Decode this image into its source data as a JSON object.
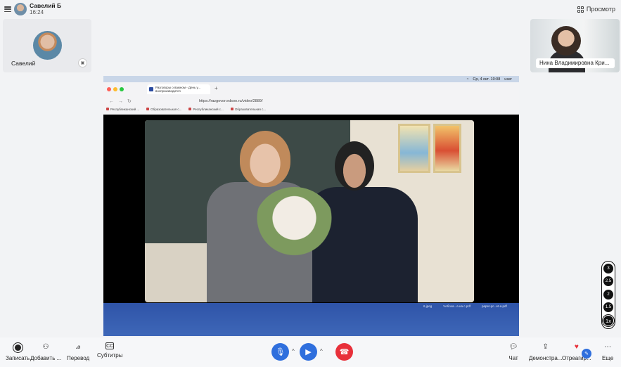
{
  "header": {
    "user_name": "Савелий Б",
    "time": "16:24",
    "view_label": "Просмотр"
  },
  "participants": {
    "self_name": "Савелий",
    "remote_name": "Нина Владимировна Кри..."
  },
  "shared_screen": {
    "mac_status": [
      "Ср, 4 окт. 10:08",
      "user"
    ],
    "tab_title": "Разговоры о важном - День у...",
    "tab_subtitle": "воспроизводится",
    "url": "https://razgovor.edsoo.ru/video/2889/",
    "bookmarks": [
      "Республиканский ...",
      "Образовательная с...",
      "Республиканский с...",
      "Образовательная с..."
    ],
    "files": [
      "6.jpeg",
      "Чебоха...а на с.pdf",
      "paper-pr...et-a.pdf"
    ]
  },
  "playback_speed": {
    "options": [
      "3",
      "2.5",
      "2",
      "1.5",
      "1x"
    ],
    "selected": "1x"
  },
  "toolbar": {
    "record": "Записать",
    "add": "Добавить ...",
    "translate": "Перевод",
    "subtitles": "Субтитры",
    "chat": "Чат",
    "demo": "Демонстра...",
    "react": "Отреагир...",
    "more": "Еще"
  },
  "colors": {
    "mic": "#2f6fdd",
    "camera": "#2f6fdd",
    "hangup": "#e8303a"
  }
}
